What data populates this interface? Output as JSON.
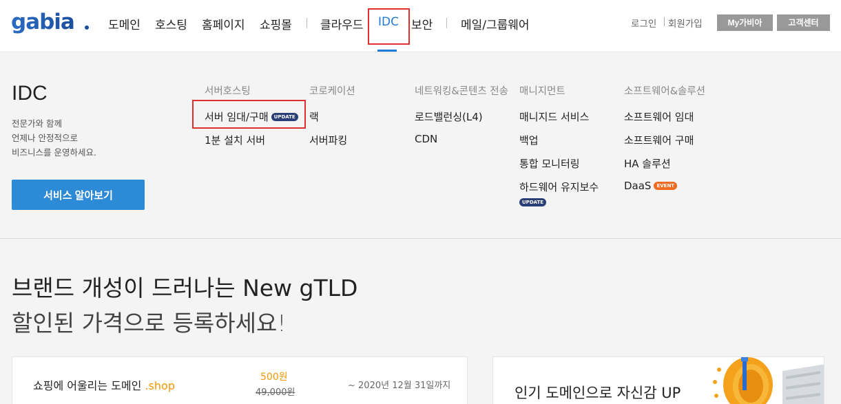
{
  "logo_text": "gabia.",
  "gnb": {
    "items": [
      "도메인",
      "호스팅",
      "홈페이지",
      "쇼핑몰",
      "클라우드",
      "IDC",
      "보안",
      "메일/그룹웨어"
    ]
  },
  "util": {
    "login": "로그인",
    "signup": "회원가입",
    "my_gabia": "My가비아",
    "support": "고객센터"
  },
  "mega": {
    "title": "IDC",
    "desc": [
      "전문가와 함께",
      "언제나 안정적으로",
      "비즈니스를 운영하세요."
    ],
    "cta": "서비스 알아보기",
    "columns": [
      {
        "head": "서버호스팅",
        "items": [
          "서버 임대/구매",
          "1분 설치 서버"
        ]
      },
      {
        "head": "코로케이션",
        "items": [
          "랙",
          "서버파킹"
        ]
      },
      {
        "head": "네트워킹&콘텐츠 전송",
        "items": [
          "로드밸런싱(L4)",
          "CDN"
        ]
      },
      {
        "head": "매니지먼트",
        "items": [
          "매니지드 서비스",
          "백업",
          "통합 모니터링",
          "하드웨어 유지보수"
        ]
      },
      {
        "head": "소프트웨어&솔루션",
        "items": [
          "소프트웨어 임대",
          "소프트웨어 구매",
          "HA 솔루션",
          "DaaS"
        ]
      }
    ],
    "badges": {
      "update": "UPDATE",
      "event": "EVENT"
    }
  },
  "hero": {
    "line1": "브랜드 개성이 드러나는 New gTLD",
    "line2": "할인된 가격으로 등록하세요!"
  },
  "promo": {
    "name": "쇼핑에 어울리는 도메인",
    "ext": ".shop",
    "price": "500원",
    "old_price": "49,000원",
    "until": "~ 2020년 12월 31일까지"
  },
  "right_card": {
    "title": "인기 도메인으로 자신감 UP"
  },
  "colors": {
    "accent": "#1e7bd6",
    "cta": "#2d8ad6",
    "highlight": "#e0302d",
    "orange": "#f39800"
  }
}
